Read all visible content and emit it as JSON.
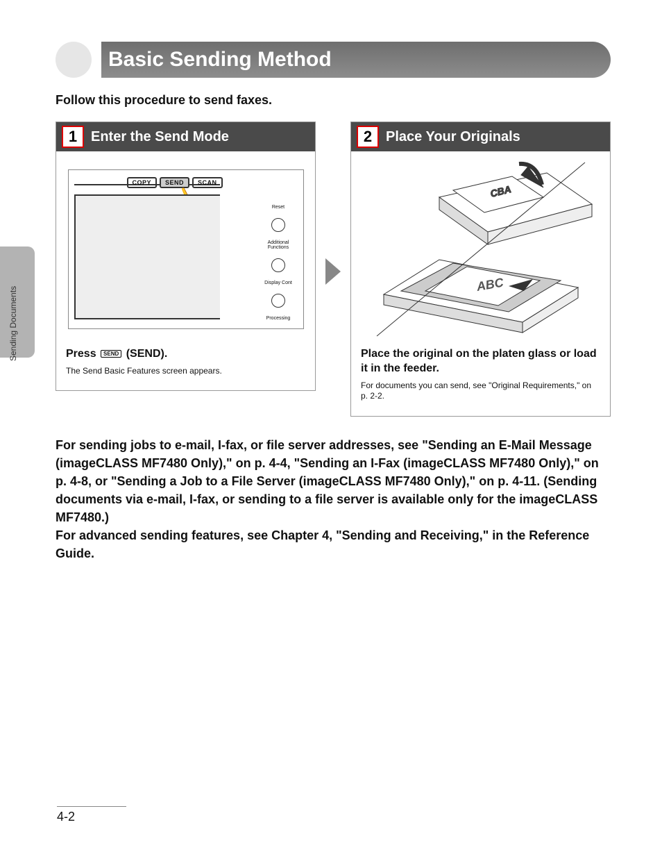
{
  "side_tab_label": "Sending Documents",
  "title": "Basic Sending Method",
  "intro": "Follow this procedure to send faxes.",
  "steps": [
    {
      "num": "1",
      "title": "Enter the Send Mode",
      "panel_buttons": [
        "COPY",
        "SEND",
        "SCAN"
      ],
      "side_labels": {
        "reset": "Reset",
        "addfunc": "Additional\nFunctions",
        "display": "Display Cont",
        "processing": "Processing"
      },
      "instruction_prefix": "Press ",
      "instruction_btn": "SEND",
      "instruction_suffix": " (SEND).",
      "note": "The Send Basic Features screen appears."
    },
    {
      "num": "2",
      "title": "Place Your Originals",
      "instruction": "Place the original on the platen glass or load it in the feeder.",
      "note": "For documents you can send, see \"Original Requirements,\" on p. 2-2."
    }
  ],
  "body_text": "For sending jobs to e-mail, I-fax, or file server addresses, see \"Sending an E-Mail Message (imageCLASS MF7480 Only),\" on p. 4-4, \"Sending an I-Fax (imageCLASS MF7480 Only),\" on p. 4-8, or \"Sending a Job to a File Server (imageCLASS MF7480 Only),\" on p. 4-11. (Sending documents via e-mail, I-fax, or sending to a file server is available only for the imageCLASS MF7480.)\nFor advanced sending features, see Chapter 4, \"Sending and Receiving,\" in the Reference Guide.",
  "page_number": "4-2"
}
